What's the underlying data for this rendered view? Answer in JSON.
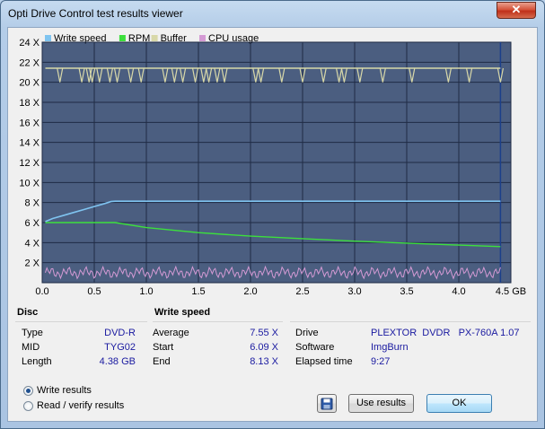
{
  "window": {
    "title": "Opti Drive Control test results viewer",
    "close_glyph": "✕"
  },
  "legend": {
    "items": [
      {
        "label": "Write speed",
        "color": "#7fc4f0"
      },
      {
        "label": "RPM",
        "color": "#3ce03c"
      },
      {
        "label": "Buffer",
        "color": "#d8d8a8"
      },
      {
        "label": "CPU usage",
        "color": "#d49ad4"
      }
    ]
  },
  "chart_data": {
    "type": "line",
    "xlabel": "GB",
    "x_ticks": [
      "0.0",
      "0.5",
      "1.0",
      "1.5",
      "2.0",
      "2.5",
      "3.0",
      "3.5",
      "4.0",
      "4.5 GB"
    ],
    "y_ticks": [
      "2 X",
      "4 X",
      "6 X",
      "8 X",
      "10 X",
      "12 X",
      "14 X",
      "16 X",
      "18 X",
      "20 X",
      "22 X",
      "24 X"
    ],
    "xlim": [
      0,
      4.5
    ],
    "ylim": [
      0,
      24
    ],
    "grid": true,
    "plot_background": "#4b5e80",
    "series": [
      {
        "name": "Write speed",
        "x": [
          0.03,
          0.1,
          0.2,
          0.3,
          0.4,
          0.5,
          0.6,
          0.66,
          0.7,
          0.8,
          1.0,
          1.5,
          2.0,
          2.5,
          3.0,
          3.5,
          4.0,
          4.4
        ],
        "y": [
          6.1,
          6.4,
          6.7,
          7.0,
          7.3,
          7.6,
          7.9,
          8.1,
          8.13,
          8.13,
          8.13,
          8.13,
          8.13,
          8.13,
          8.13,
          8.13,
          8.13,
          8.13
        ]
      },
      {
        "name": "RPM",
        "x": [
          0.03,
          0.7,
          1.0,
          1.5,
          2.0,
          2.5,
          3.0,
          3.5,
          4.0,
          4.4
        ],
        "y": [
          6.0,
          6.0,
          5.5,
          5.0,
          4.65,
          4.4,
          4.15,
          3.95,
          3.75,
          3.6
        ]
      },
      {
        "name": "Buffer",
        "x": [
          0.03,
          4.4
        ],
        "y": [
          21.4,
          21.4
        ]
      },
      {
        "name": "CPU usage",
        "x": [
          0.03,
          1.0,
          2.0,
          3.0,
          4.0,
          4.4
        ],
        "y": [
          1.0,
          1.0,
          1.0,
          1.0,
          1.0,
          1.0
        ]
      }
    ]
  },
  "disc": {
    "heading": "Disc",
    "rows": [
      {
        "label": "Type",
        "value": "DVD-R"
      },
      {
        "label": "MID",
        "value": "TYG02"
      },
      {
        "label": "Length",
        "value": "4.38 GB"
      }
    ]
  },
  "write_speed": {
    "heading": "Write speed",
    "rows": [
      {
        "label": "Average",
        "value": "7.55 X"
      },
      {
        "label": "Start",
        "value": "6.09 X"
      },
      {
        "label": "End",
        "value": "8.13 X"
      }
    ]
  },
  "info": {
    "rows": [
      {
        "label": "Drive",
        "value": "PLEXTOR  DVDR   PX-760A 1.07"
      },
      {
        "label": "Software",
        "value": "ImgBurn"
      },
      {
        "label": "Elapsed time",
        "value": "9:27"
      }
    ]
  },
  "options": {
    "write_results": "Write results",
    "read_verify_results": "Read / verify results",
    "selected": "Write results"
  },
  "buttons": {
    "use_results": "Use results",
    "ok": "OK"
  }
}
